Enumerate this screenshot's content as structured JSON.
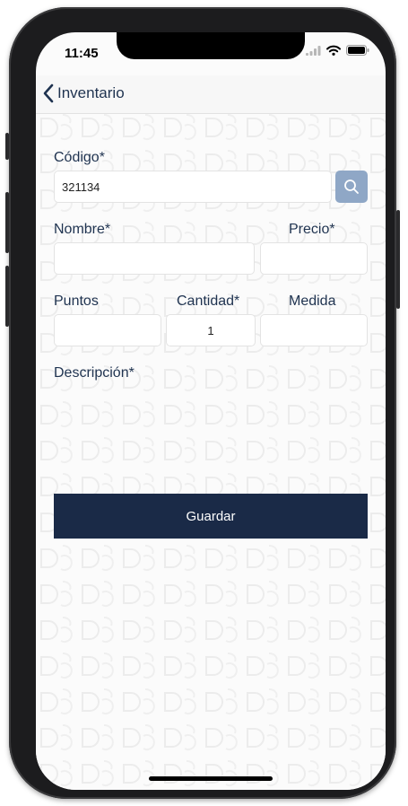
{
  "status_bar": {
    "time": "11:45"
  },
  "navbar": {
    "back_label": "Inventario"
  },
  "form": {
    "codigo_label": "Código*",
    "codigo_value": "321134",
    "nombre_label": "Nombre*",
    "nombre_value": "",
    "precio_label": "Precio*",
    "precio_value": "",
    "puntos_label": "Puntos",
    "puntos_value": "",
    "cantidad_label": "Cantidad*",
    "cantidad_value": "1",
    "medida_label": "Medida",
    "medida_value": "",
    "descripcion_label": "Descripción*",
    "descripcion_value": ""
  },
  "actions": {
    "save_label": "Guardar"
  },
  "colors": {
    "accent": "#1f3350",
    "button_primary": "#1a2a47",
    "search_button": "#8fa7c6"
  },
  "icons": [
    "chevron-left-icon",
    "search-icon",
    "signal-icon",
    "wifi-icon",
    "battery-icon"
  ]
}
